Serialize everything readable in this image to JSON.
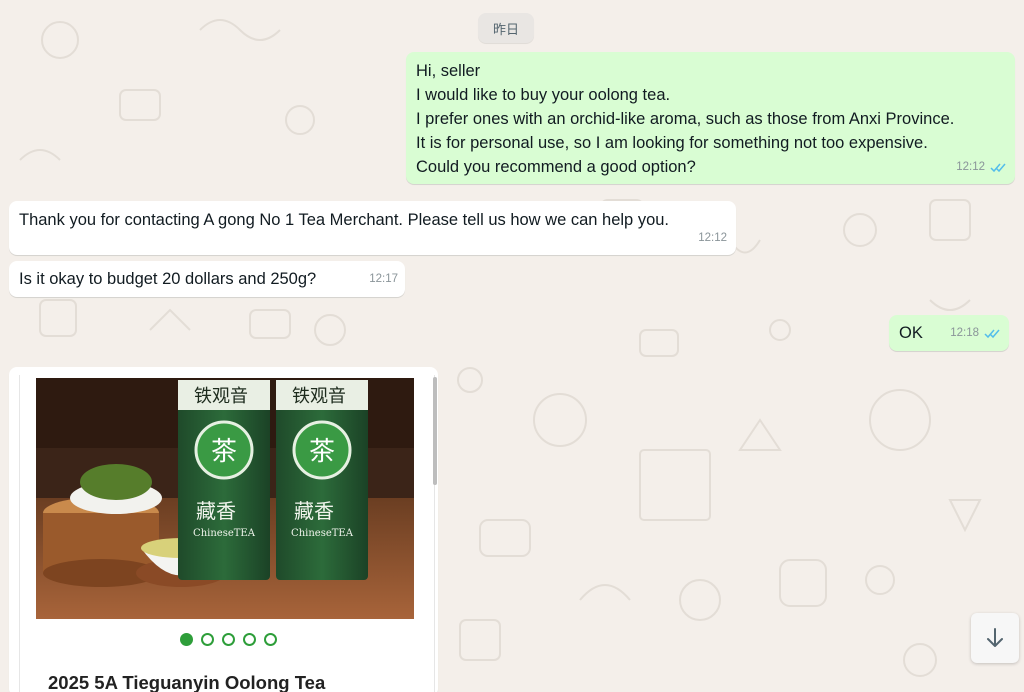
{
  "chat": {
    "date_chip": "昨日",
    "messages": [
      {
        "direction": "out",
        "lines": [
          "Hi, seller",
          "I would like to buy your oolong tea.",
          "I prefer ones with an orchid-like aroma, such as those from Anxi Province.",
          "It is for personal use, so I am looking for something not too expensive.",
          "Could you recommend a good option?"
        ],
        "time": "12:12",
        "status": "read"
      },
      {
        "direction": "in",
        "text": "Thank you for contacting A gong No 1 Tea Merchant. Please tell us how we can help you.",
        "time": "12:12"
      },
      {
        "direction": "in",
        "text": "Is it okay to budget 20 dollars and 250g?",
        "time": "12:17"
      },
      {
        "direction": "out",
        "text": "OK",
        "time": "12:18",
        "status": "read"
      }
    ],
    "product": {
      "title": "2025 5A Tieguanyin Oolong Tea",
      "package_text": "铁观音",
      "package_sub": "藏香",
      "package_en": "ChineseTEA",
      "package_seal": "茶",
      "carousel_count": 5,
      "carousel_active": 0
    }
  },
  "colors": {
    "outgoing_bubble": "#d9fdd3",
    "incoming_bubble": "#ffffff",
    "read_ticks": "#53bdeb",
    "carousel_green": "#2e9e3a"
  },
  "icons": {
    "read_receipt": "double-check-icon",
    "scroll_down": "arrow-down-icon"
  }
}
